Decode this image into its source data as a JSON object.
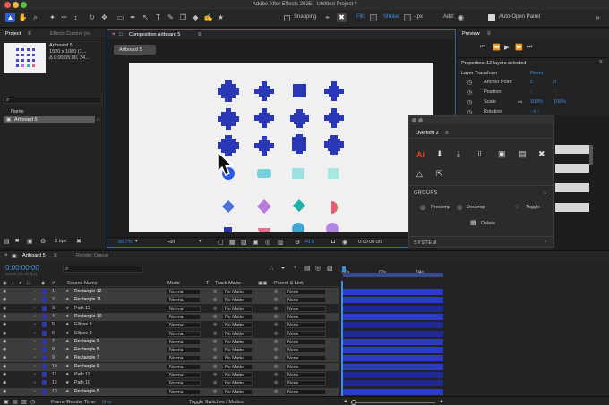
{
  "window": {
    "title": "Adobe After Effects 2025 - Untitled Project *"
  },
  "toolbar": {
    "snapping": "Snapping",
    "fill": "Fill:",
    "stroke": "Stroke:",
    "stroke_value": "- px",
    "add": "Add:",
    "auto_open": "Auto-Open Panel"
  },
  "project": {
    "tab": "Project",
    "effects_tab": "Effects Control (nc",
    "item_name": "Artboard 5",
    "item_size": "1920 x 1080 (1...",
    "item_duration": "Δ 0:00:05:00, 24...",
    "name_header": "Name",
    "item_row": "Artboard 5",
    "bpc": "8 bpc"
  },
  "composition": {
    "tab": "Composition Artboard 5",
    "sub_tab": "Artboard 5",
    "zoom": "65.7%",
    "quality": "Full",
    "exposure": "+0.0",
    "timecode": "0:00:00:00"
  },
  "preview": {
    "tab": "Preview"
  },
  "properties": {
    "header": "Properties: 12 layers selected",
    "section": "Layer Transform",
    "reset": "Reset",
    "anchor": "Anchor Point",
    "anchor_x": "0",
    "anchor_y": "0",
    "position": "Position",
    "position_x": "-",
    "position_y": "-",
    "scale": "Scale",
    "scale_x": "100%",
    "scale_y": "100%",
    "rotation": "Rotation",
    "rotation_val": "- x -"
  },
  "overlord": {
    "title": "Overlord 2",
    "groups": "GROUPS",
    "precomp": "Precomp",
    "decomp": "Decomp",
    "toggle": "Toggle",
    "delete": "Delete",
    "system": "SYSTEM"
  },
  "timeline": {
    "tab": "Artboard 5",
    "render_queue": "Render Queue",
    "timecode": "0:00:00:00",
    "fps": "00000 (24.00 fps)",
    "col_source": "Source Name",
    "col_mode": "Mode",
    "col_t": "T",
    "col_matte": "Track Matte",
    "col_parent": "Parent & Link",
    "ruler_0": ":00s",
    "ruler_1": "02s",
    "ruler_2": "04s",
    "layers": [
      {
        "num": "1",
        "name": "Rectangle 12",
        "mode": "Normal",
        "matte": "No Matte",
        "parent": "None",
        "sel": true
      },
      {
        "num": "2",
        "name": "Rectangle 11",
        "mode": "Normal",
        "matte": "No Matte",
        "parent": "None",
        "sel": true
      },
      {
        "num": "3",
        "name": "Path 12",
        "mode": "Normal",
        "matte": "No Matte",
        "parent": "None",
        "sel": false
      },
      {
        "num": "4",
        "name": "Rectangle 10",
        "mode": "Normal",
        "matte": "No Matte",
        "parent": "None",
        "sel": true
      },
      {
        "num": "5",
        "name": "Ellipse 9",
        "mode": "Normal",
        "matte": "No Matte",
        "parent": "None",
        "sel": false
      },
      {
        "num": "6",
        "name": "Ellipse 8",
        "mode": "Normal",
        "matte": "No Matte",
        "parent": "None",
        "sel": false
      },
      {
        "num": "7",
        "name": "Rectangle 9",
        "mode": "Normal",
        "matte": "No Matte",
        "parent": "None",
        "sel": true
      },
      {
        "num": "8",
        "name": "Rectangle 8",
        "mode": "Normal",
        "matte": "No Matte",
        "parent": "None",
        "sel": true
      },
      {
        "num": "9",
        "name": "Rectangle 7",
        "mode": "Normal",
        "matte": "No Matte",
        "parent": "None",
        "sel": true
      },
      {
        "num": "10",
        "name": "Rectangle 6",
        "mode": "Normal",
        "matte": "No Matte",
        "parent": "None",
        "sel": true
      },
      {
        "num": "11",
        "name": "Path 11",
        "mode": "Normal",
        "matte": "No Matte",
        "parent": "None",
        "sel": false
      },
      {
        "num": "12",
        "name": "Path 10",
        "mode": "Normal",
        "matte": "No Matte",
        "parent": "None",
        "sel": false
      },
      {
        "num": "13",
        "name": "Rectangle 5",
        "mode": "Normal",
        "matte": "No Matte",
        "parent": "None",
        "sel": true
      }
    ],
    "frame_render": "Frame Render Time:",
    "frame_render_val": "0ms",
    "toggle_switches": "Toggle Switches / Modes"
  },
  "colors": {
    "accent": "#2d5fd0",
    "layer_label": "#2a3aa8",
    "ov_red": "#e8452c"
  }
}
